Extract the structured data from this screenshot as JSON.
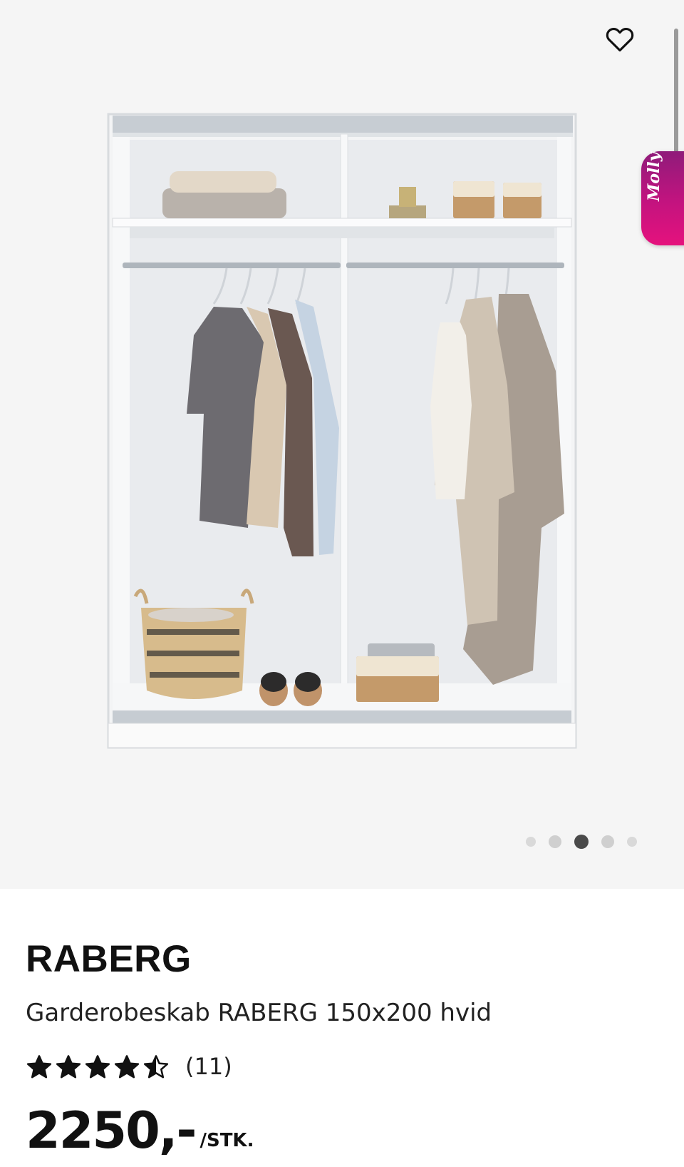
{
  "product": {
    "brand": "RABERG",
    "name": "Garderobeskab RABERG 150x200 hvid",
    "rating": 4.5,
    "rating_max": 5,
    "review_count": "(11)",
    "price": "2250,-",
    "unit": "/STK."
  },
  "gallery": {
    "image_count": 5,
    "active_index": 2,
    "favorite_icon": "heart-outline-icon"
  },
  "chat_widget": {
    "label": "Molly",
    "color_top": "#8f1b7a",
    "color_bottom": "#e5127d"
  }
}
